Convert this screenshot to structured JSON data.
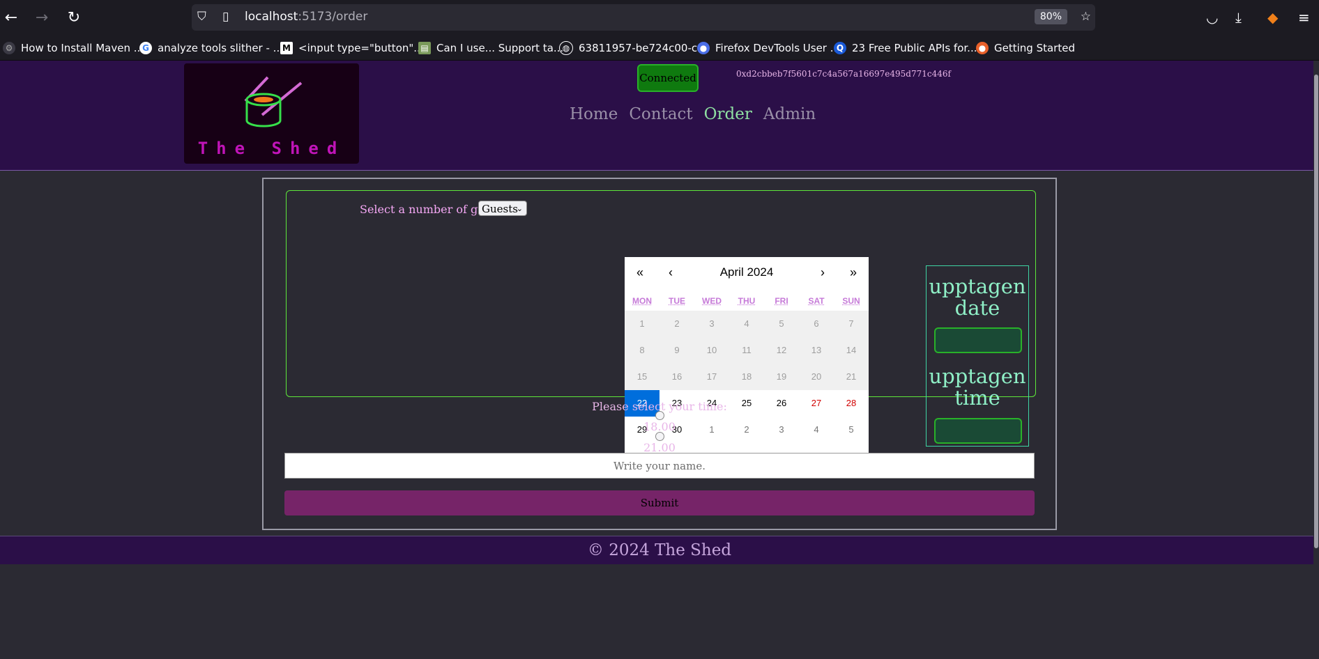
{
  "browser": {
    "url_host": "localhost",
    "url_path": ":5173/order",
    "zoom": "80%",
    "bookmarks": [
      "How to Install Maven ...",
      "analyze tools slither - ...",
      "<input type=\"button\"...",
      "Can I use... Support ta...",
      "63811957-be724c00-c...",
      "Firefox DevTools User ...",
      "23 Free Public APIs for...",
      "Getting Started"
    ]
  },
  "header": {
    "logo_text": "The Shed",
    "connect_label": "Connected",
    "wallet_address": "0xd2cbbeb7f5601c7c4a567a16697e495d771c446f",
    "nav": [
      "Home",
      "Contact",
      "Order",
      "Admin"
    ],
    "active_nav": "Order"
  },
  "order": {
    "guests_label": "Select a number of guests:",
    "guests_select_value": "Guests",
    "calendar": {
      "month_label": "April 2024",
      "nav": [
        "«",
        "‹",
        "›",
        "»"
      ],
      "weekdays": [
        "MON",
        "TUE",
        "WED",
        "THU",
        "FRI",
        "SAT",
        "SUN"
      ],
      "weeks": [
        [
          "1",
          "2",
          "3",
          "4",
          "5",
          "6",
          "7"
        ],
        [
          "8",
          "9",
          "10",
          "11",
          "12",
          "13",
          "14"
        ],
        [
          "15",
          "16",
          "17",
          "18",
          "19",
          "20",
          "21"
        ],
        [
          "22",
          "23",
          "24",
          "25",
          "26",
          "27",
          "28"
        ],
        [
          "29",
          "30",
          "1",
          "2",
          "3",
          "4",
          "5"
        ]
      ],
      "selected_day": "22"
    },
    "upptagen_date_heading": "upptagen date",
    "upptagen_time_heading": "upptagen time",
    "time_prompt": "Please select your time:",
    "time_options": [
      "18.00",
      "21.00"
    ],
    "name_placeholder": "Write your name.",
    "submit_label": "Submit"
  },
  "footer": {
    "text": "© 2024 The Shed"
  },
  "colors": {
    "header_bg": "#2b0f48",
    "accent_green": "#5ee83a",
    "submit_bg": "#762468",
    "selected_day": "#006edc"
  }
}
